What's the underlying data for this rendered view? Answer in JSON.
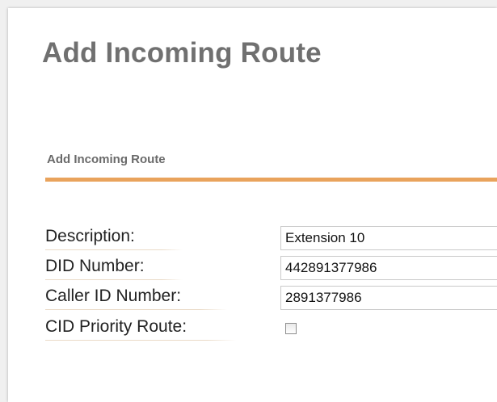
{
  "header": {
    "title": "Add Incoming Route"
  },
  "form": {
    "section_title": "Add Incoming Route",
    "accent_color": "#e9a35c",
    "fields": {
      "description": {
        "label": "Description:",
        "value": "Extension 10"
      },
      "did_number": {
        "label": "DID Number:",
        "value": "442891377986"
      },
      "caller_id_number": {
        "label": "Caller ID Number:",
        "value": "2891377986"
      },
      "cid_priority_route": {
        "label": "CID Priority Route:",
        "checked": false
      }
    }
  }
}
